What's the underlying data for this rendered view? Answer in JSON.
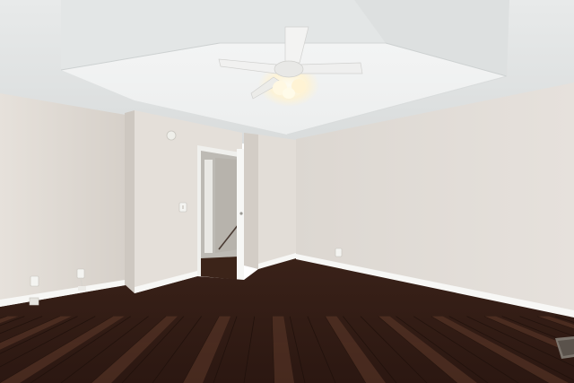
{
  "colors": {
    "ceiling": "#eceeee",
    "ceiling_shadow": "#d7dadb",
    "tray_ceiling": "#f5f6f6",
    "wall_left": "#e1dcd6",
    "wall_right": "#e4dfd9",
    "wall_shadow": "#cfc9c2",
    "baseboard": "#f7f7f5",
    "floor_dark": "#2a1812",
    "floor_mid": "#4a2c20",
    "floor_light": "#6b4433",
    "door_frame": "#f2f2ef",
    "hallway_wall": "#c9c6c0",
    "fan_blade": "#f1f1f0",
    "light_glow": "#fff5d6"
  },
  "icons": {
    "fan": "ceiling-fan-icon",
    "outlet": "wall-outlet-icon",
    "switch": "light-switch-icon",
    "vent": "floor-vent-icon",
    "smoke_detector": "smoke-detector-icon"
  }
}
